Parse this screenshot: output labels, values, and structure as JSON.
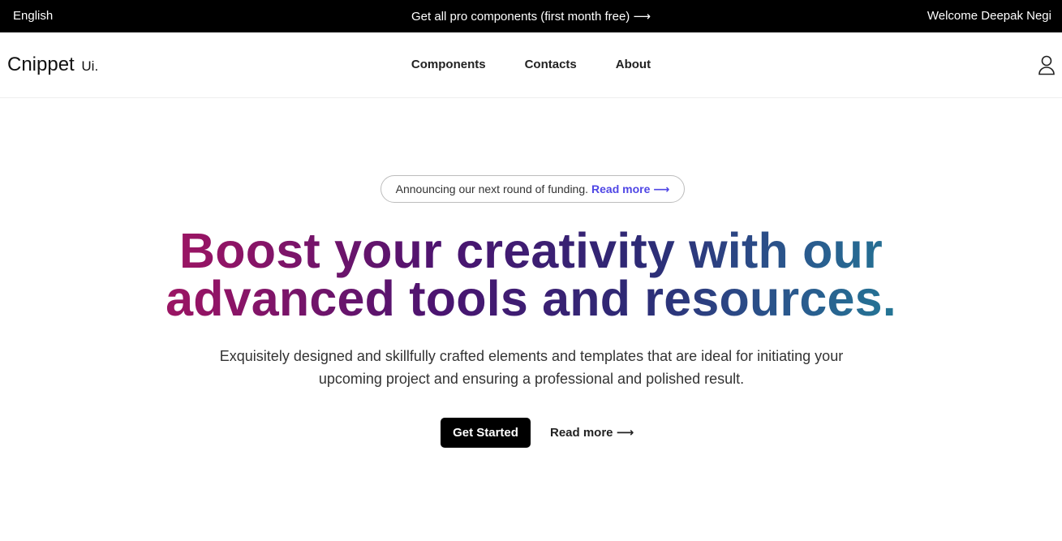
{
  "topbar": {
    "language": "English",
    "promo": "Get all pro components (first month free) ⟶",
    "welcome": "Welcome Deepak Negi"
  },
  "header": {
    "logo_main": "Cnippet",
    "logo_suffix": "Ui.",
    "nav": [
      "Components",
      "Contacts",
      "About"
    ],
    "user_icon": "user-icon"
  },
  "hero": {
    "announcement": "Announcing our next round of funding.",
    "announcement_link": "Read more ⟶",
    "title_line1": "Boost your creativity with our",
    "title_line2": "advanced tools and resources.",
    "subtitle_line1": "Exquisitely designed and skillfully crafted elements and templates that are ideal for initiating your",
    "subtitle_line2": "upcoming project and ensuring a professional and polished result.",
    "primary_cta": "Get Started",
    "secondary_cta": "Read more ⟶"
  },
  "colors": {
    "gradient_start": "#c2185b",
    "gradient_mid": "#4a1470",
    "gradient_end": "#1aa3a0",
    "link_accent": "#4f46e5"
  }
}
